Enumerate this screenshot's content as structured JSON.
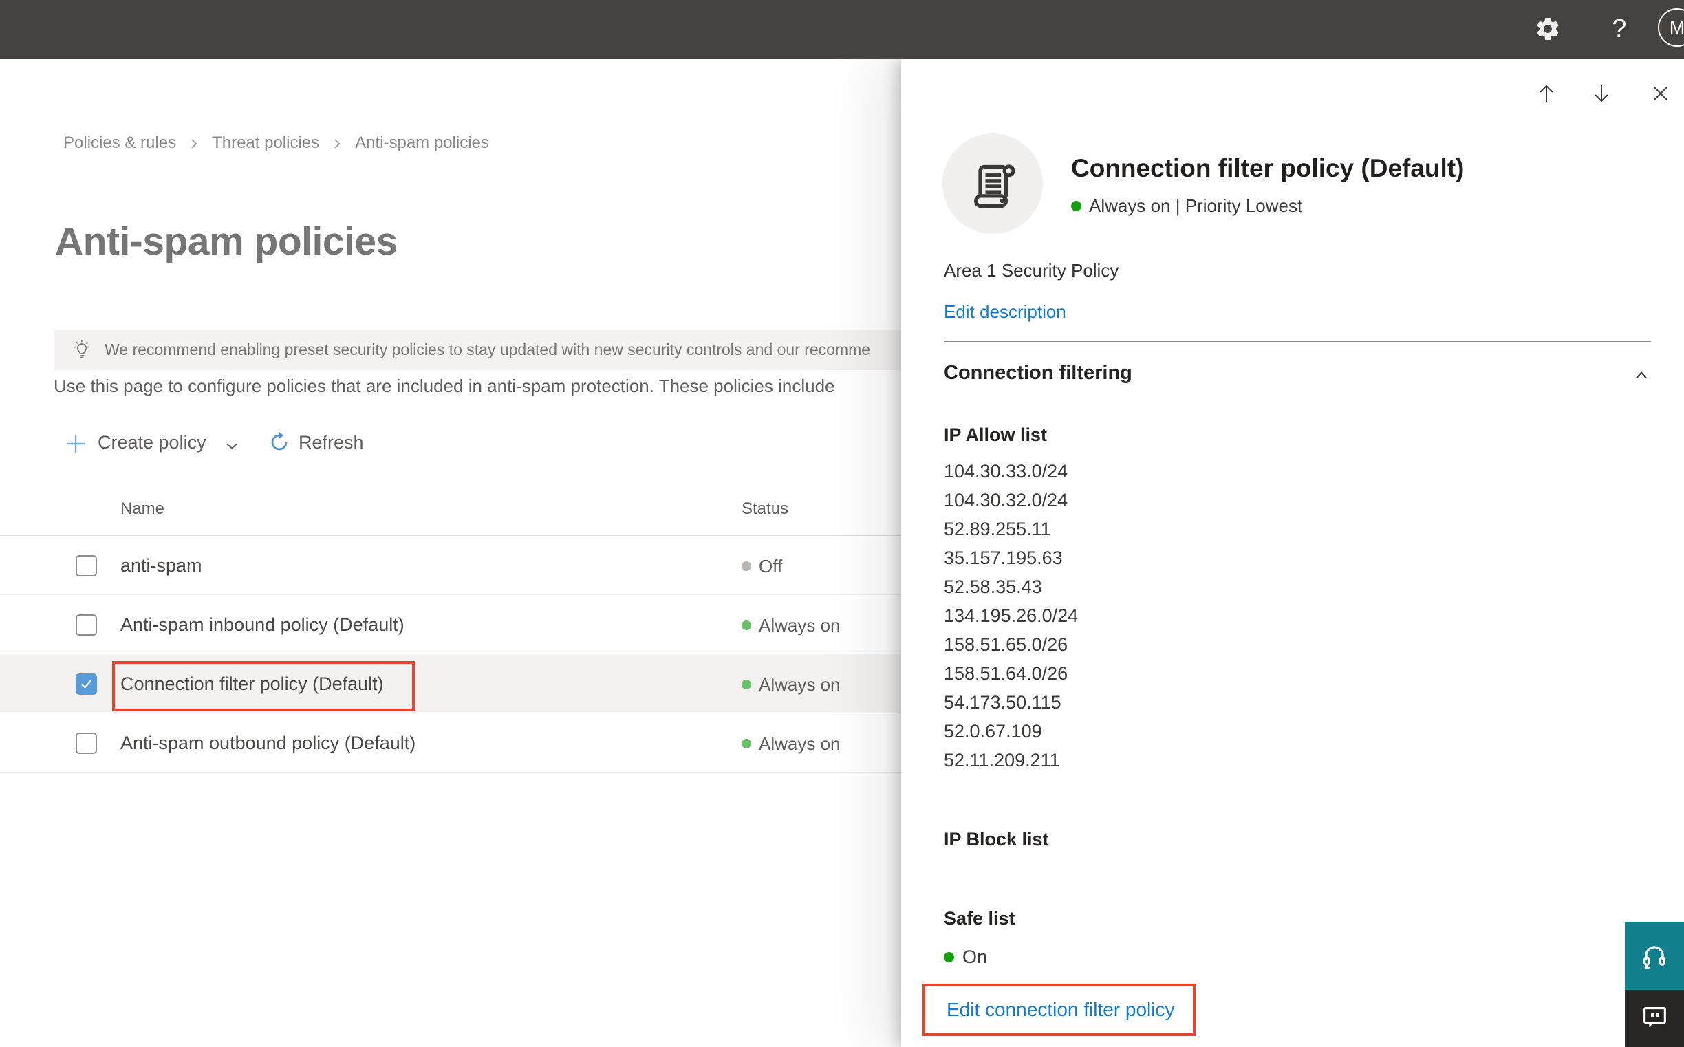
{
  "topbar": {
    "help_glyph": "?",
    "avatar_initial": "M"
  },
  "breadcrumb": {
    "items": [
      "Policies & rules",
      "Threat policies",
      "Anti-spam policies"
    ]
  },
  "page": {
    "title": "Anti-spam policies",
    "banner_text": "We recommend enabling preset security policies to stay updated with new security controls and our recomme",
    "intro_text": "Use this page to configure policies that are included in anti-spam protection. These policies include"
  },
  "toolbar": {
    "create_label": "Create policy",
    "refresh_label": "Refresh"
  },
  "table": {
    "columns": [
      "Name",
      "Status"
    ],
    "rows": [
      {
        "name": "anti-spam",
        "status": "Off",
        "status_color": "#b8b5b2",
        "checked": false,
        "selected": false
      },
      {
        "name": "Anti-spam inbound policy (Default)",
        "status": "Always on",
        "status_color": "#6abf69",
        "checked": false,
        "selected": false
      },
      {
        "name": "Connection filter policy (Default)",
        "status": "Always on",
        "status_color": "#6abf69",
        "checked": true,
        "selected": true
      },
      {
        "name": "Anti-spam outbound policy (Default)",
        "status": "Always on",
        "status_color": "#6abf69",
        "checked": false,
        "selected": false
      }
    ]
  },
  "panel": {
    "title": "Connection filter policy (Default)",
    "status_text": "Always on | Priority Lowest",
    "status_color": "#12a10d",
    "description": "Area 1 Security Policy",
    "edit_description_label": "Edit description",
    "section": {
      "title": "Connection filtering"
    },
    "ip_allow": {
      "title": "IP Allow list",
      "items": [
        "104.30.33.0/24",
        "104.30.32.0/24",
        "52.89.255.11",
        "35.157.195.63",
        "52.58.35.43",
        "134.195.26.0/24",
        "158.51.65.0/26",
        "158.51.64.0/26",
        "54.173.50.115",
        "52.0.67.109",
        "52.11.209.211"
      ]
    },
    "ip_block": {
      "title": "IP Block list"
    },
    "safe_list": {
      "title": "Safe list",
      "status": "On",
      "status_color": "#12a10d"
    },
    "edit_link_label": "Edit connection filter policy"
  },
  "colors": {
    "accent_red": "#e8432c",
    "link_blue": "#0f7bd3",
    "teal": "#12808c"
  }
}
